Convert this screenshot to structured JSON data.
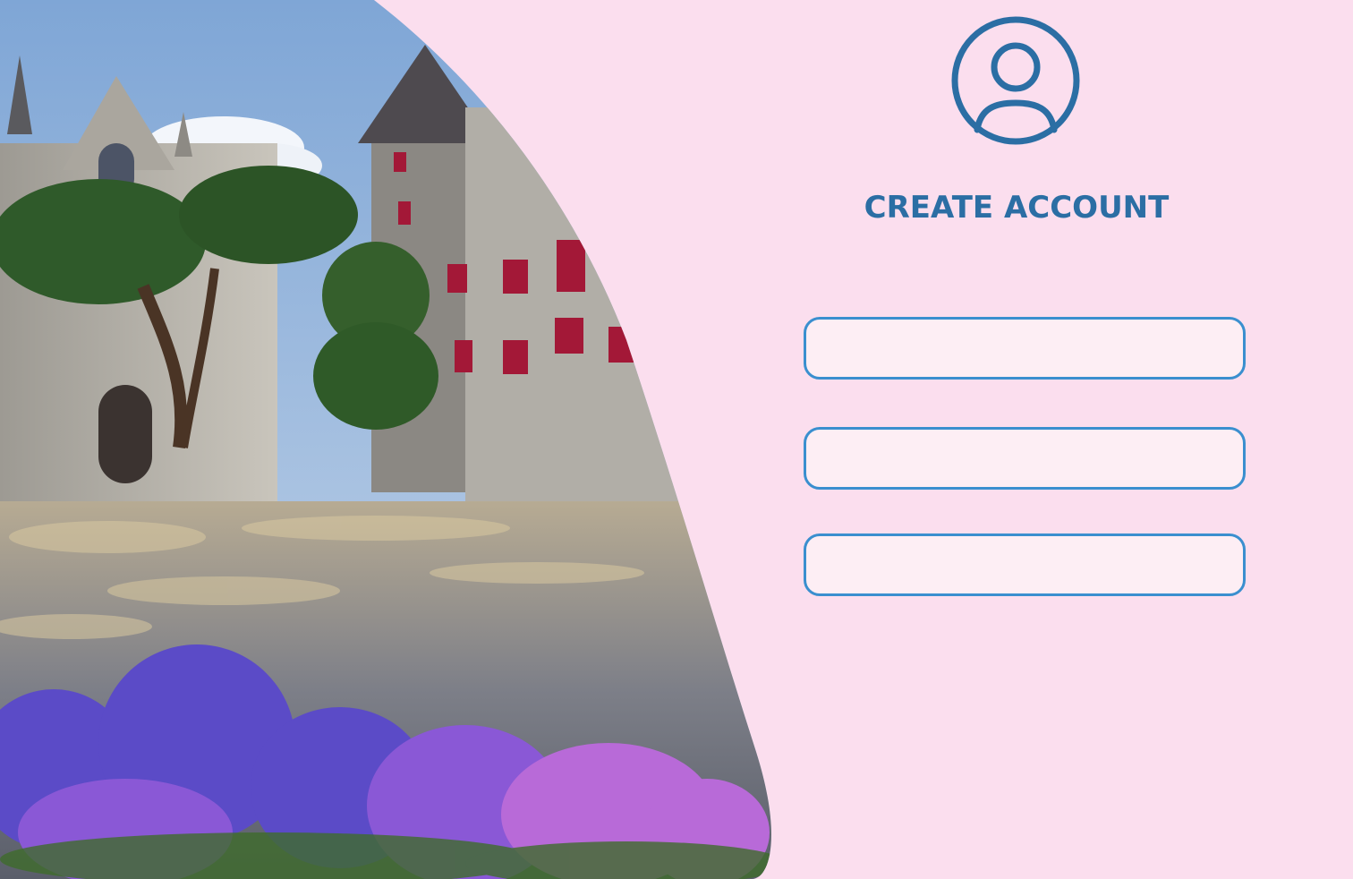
{
  "form": {
    "title": "CREATE ACCOUNT",
    "fields": [
      {
        "value": "",
        "placeholder": ""
      },
      {
        "value": "",
        "placeholder": ""
      },
      {
        "value": "",
        "placeholder": ""
      }
    ]
  },
  "icons": {
    "avatar": "user-circle-icon"
  },
  "colors": {
    "background": "#fbdeee",
    "accent": "#2b6ea4",
    "field_border": "#3a8fcf",
    "field_fill": "#fdeef4"
  }
}
